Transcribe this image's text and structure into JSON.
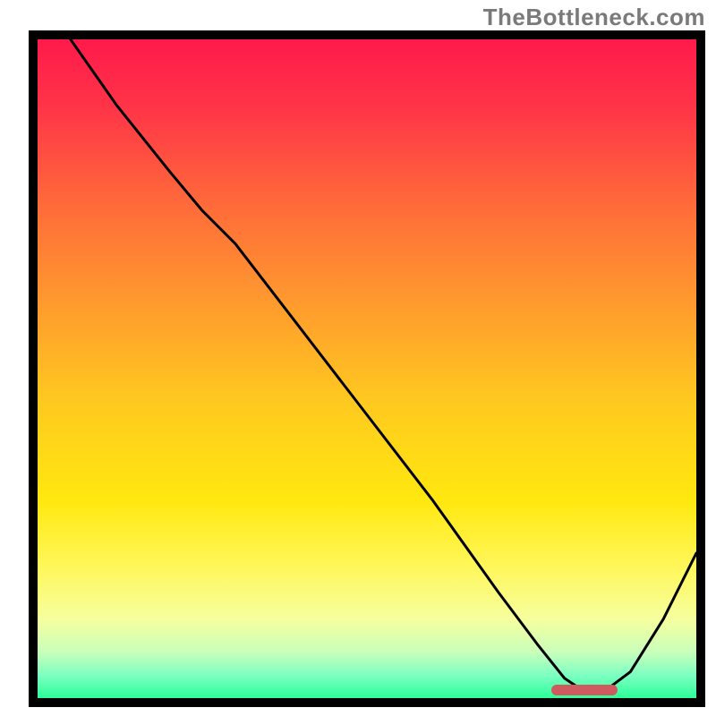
{
  "watermark": {
    "text": "TheBottleneck.com"
  },
  "colors": {
    "frame": "#000000",
    "curve": "#000000",
    "marker": "#cf5b5f",
    "gradient_stops": [
      {
        "offset": 0.0,
        "color": "#ff1a4b"
      },
      {
        "offset": 0.1,
        "color": "#ff3348"
      },
      {
        "offset": 0.25,
        "color": "#ff6a3a"
      },
      {
        "offset": 0.4,
        "color": "#ff9a2e"
      },
      {
        "offset": 0.55,
        "color": "#ffc91f"
      },
      {
        "offset": 0.7,
        "color": "#ffe80f"
      },
      {
        "offset": 0.8,
        "color": "#fff75a"
      },
      {
        "offset": 0.88,
        "color": "#f6ff9e"
      },
      {
        "offset": 0.93,
        "color": "#c9ffba"
      },
      {
        "offset": 0.965,
        "color": "#7dffc1"
      },
      {
        "offset": 1.0,
        "color": "#2cff9a"
      }
    ]
  },
  "chart_data": {
    "type": "line",
    "title": "",
    "xlabel": "",
    "ylabel": "",
    "xlim": [
      0,
      100
    ],
    "ylim": [
      0,
      100
    ],
    "note": "Axes are implicit (no tick labels in image). Values are percentage of inner plot area: x left→right, y bottom→top.",
    "series": [
      {
        "name": "bottleneck-curve",
        "x": [
          5,
          12,
          20,
          25,
          30,
          40,
          50,
          60,
          70,
          76,
          80,
          83,
          86,
          90,
          95,
          100
        ],
        "y": [
          100,
          90,
          80,
          74,
          69,
          56,
          43,
          30,
          16,
          8,
          3,
          1,
          1,
          4,
          12,
          22
        ]
      }
    ],
    "marker": {
      "name": "optimal-range",
      "x_start": 78,
      "x_end": 88,
      "y": 1.2
    }
  }
}
